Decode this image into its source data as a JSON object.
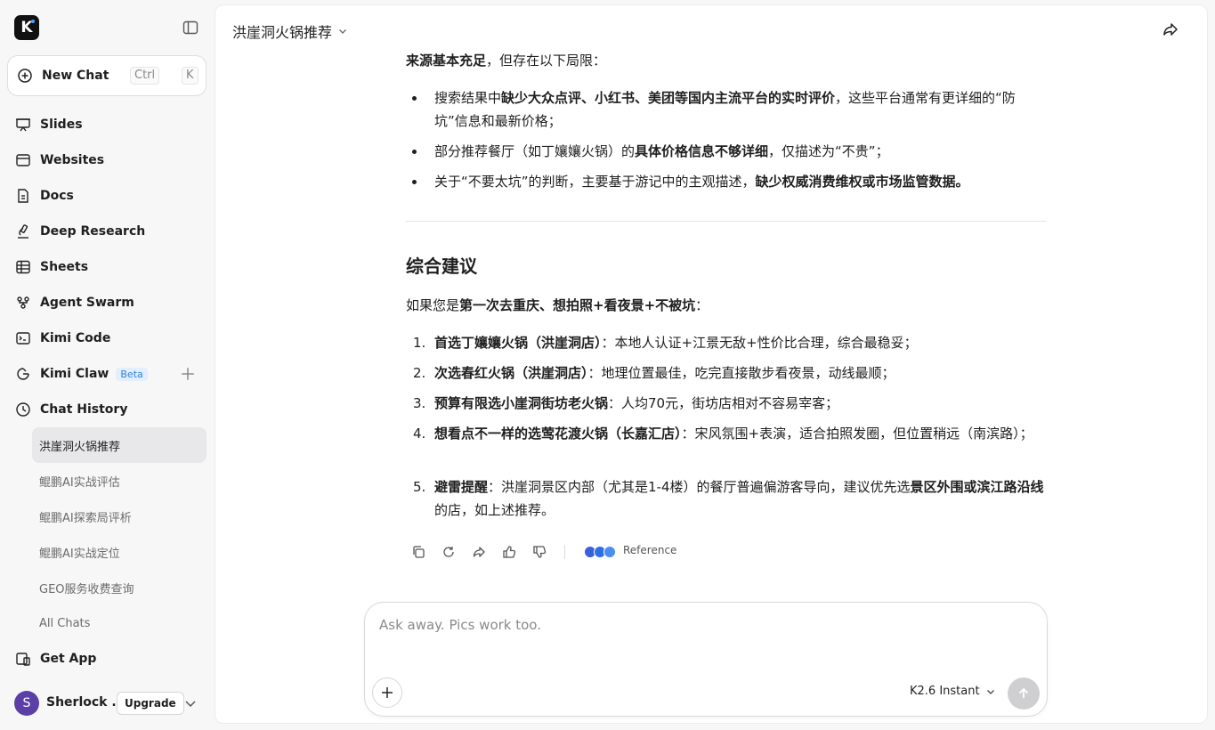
{
  "app": {
    "logo_letter": "K",
    "accent_color": "#2f7fd8"
  },
  "sidebar": {
    "new_chat": {
      "label": "New Chat",
      "shortcut_ctrl": "Ctrl",
      "shortcut_key": "K"
    },
    "items": [
      {
        "label": "Slides",
        "icon": "slides-icon"
      },
      {
        "label": "Websites",
        "icon": "websites-icon"
      },
      {
        "label": "Docs",
        "icon": "docs-icon"
      },
      {
        "label": "Deep Research",
        "icon": "deep-research-icon"
      },
      {
        "label": "Sheets",
        "icon": "sheets-icon"
      },
      {
        "label": "Agent Swarm",
        "icon": "agent-swarm-icon"
      },
      {
        "label": "Kimi Code",
        "icon": "terminal-icon"
      },
      {
        "label": "Kimi Claw",
        "icon": "claw-icon",
        "badge": "Beta"
      },
      {
        "label": "Chat History",
        "icon": "history-icon"
      }
    ],
    "history": [
      {
        "label": "洪崖洞火锅推荐",
        "active": true
      },
      {
        "label": "鲲鹏AI实战评估",
        "active": false
      },
      {
        "label": "鲲鹏AI探索局评析",
        "active": false
      },
      {
        "label": "鲲鹏AI实战定位",
        "active": false
      },
      {
        "label": "GEO服务收费查询",
        "active": false
      },
      {
        "label": "All Chats",
        "active": false
      }
    ],
    "get_app": "Get App",
    "user": {
      "initial": "S",
      "name": "Sherlock ...",
      "upgrade": "Upgrade"
    }
  },
  "header": {
    "title": "洪崖洞火锅推荐"
  },
  "message": {
    "intro": {
      "bold": "来源基本充足",
      "rest": "，但存在以下局限："
    },
    "bullets": [
      {
        "pre": "搜索结果中",
        "bold": "缺少大众点评、小红书、美团等国内主流平台的实时评价",
        "post": "，这些平台通常有更详细的“防坑”信息和最新价格；"
      },
      {
        "pre": "部分推荐餐厅（如丁孃孃火锅）的",
        "bold": "具体价格信息不够详细",
        "post": "，仅描述为“不贵”；"
      },
      {
        "pre": "关于“不要太坑”的判断，主要基于游记中的主观描述，",
        "bold": "缺少权威消费维权或市场监管数据。",
        "post": ""
      }
    ],
    "section_title": "综合建议",
    "lead": {
      "pre": "如果您是",
      "bold": "第一次去重庆、想拍照+看夜景+不被坑",
      "post": "："
    },
    "list": [
      {
        "num": "1.",
        "bold": "首选丁孃孃火锅（洪崖洞店）",
        "rest": "：本地人认证+江景无敌+性价比合理，综合最稳妥；"
      },
      {
        "num": "2.",
        "bold": "次选春红火锅（洪崖洞店）",
        "rest": "：地理位置最佳，吃完直接散步看夜景，动线最顺；"
      },
      {
        "num": "3.",
        "bold": "预算有限选小崖洞街坊老火锅",
        "rest": "：人均70元，街坊店相对不容易宰客；"
      },
      {
        "num": "4.",
        "bold": "想看点不一样的选莺花渡火锅（长嘉汇店）",
        "rest": "：宋风氛围+表演，适合拍照发圈，但位置稍远（南滨路）；"
      },
      {
        "num": "5.",
        "bold": "避雷提醒",
        "rest": "：洪崖洞景区内部（尤其是1-4楼）的餐厅普遍偏游客导向，建议优先选",
        "bold2": "景区外围或滨江路沿线",
        "rest2": "的店，如上述推荐。"
      }
    ],
    "reference_label": "Reference"
  },
  "composer": {
    "placeholder": "Ask away. Pics work too.",
    "model": "K2.6 Instant"
  }
}
